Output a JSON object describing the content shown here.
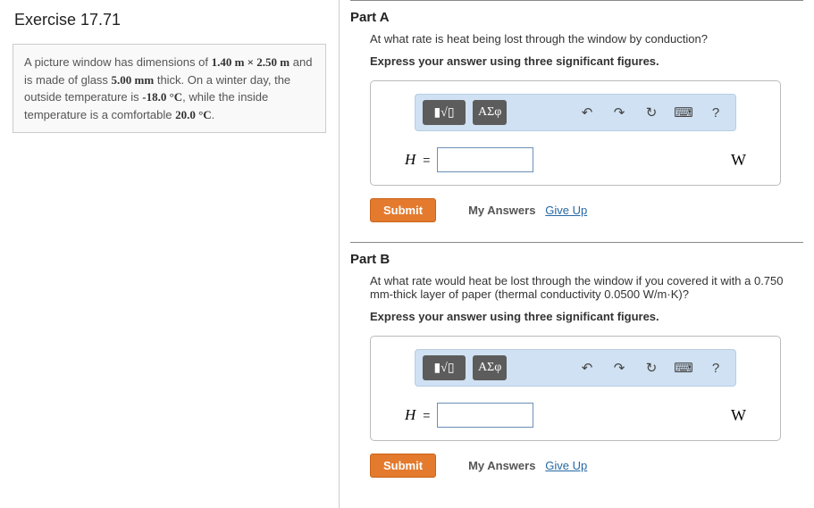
{
  "exercise_title": "Exercise 17.71",
  "problem": {
    "pre1": "A picture window has dimensions of ",
    "dim": "1.40 m × 2.50 m",
    "mid1": " and is made of glass ",
    "thick": "5.00 mm",
    "mid2": " thick. On a winter day, the outside temperature is ",
    "tout": "-18.0 °C",
    "mid3": ", while the inside temperature is a comfortable ",
    "tin": "20.0 °C",
    "post": "."
  },
  "partA": {
    "title": "Part A",
    "question": "At what rate is heat being lost through the window by conduction?",
    "instruction": "Express your answer using three significant figures.",
    "variable": "H",
    "unit": "W"
  },
  "partB": {
    "title": "Part B",
    "question_pre": "At what rate would heat be lost through the window if you covered it with a ",
    "paper_thick": "0.750 mm",
    "question_mid": "-thick layer of paper (thermal conductivity ",
    "k_paper": "0.0500 W/m·K",
    "question_post": ")?",
    "instruction": "Express your answer using three significant figures.",
    "variable": "H",
    "unit": "W"
  },
  "toolbar": {
    "templates_label": "▮√▯",
    "greek_label": "ΑΣφ",
    "undo": "↶",
    "redo": "↷",
    "reset": "↻",
    "keyboard": "⌨",
    "help": "?"
  },
  "buttons": {
    "submit": "Submit",
    "my_answers": "My Answers",
    "give_up": "Give Up"
  }
}
